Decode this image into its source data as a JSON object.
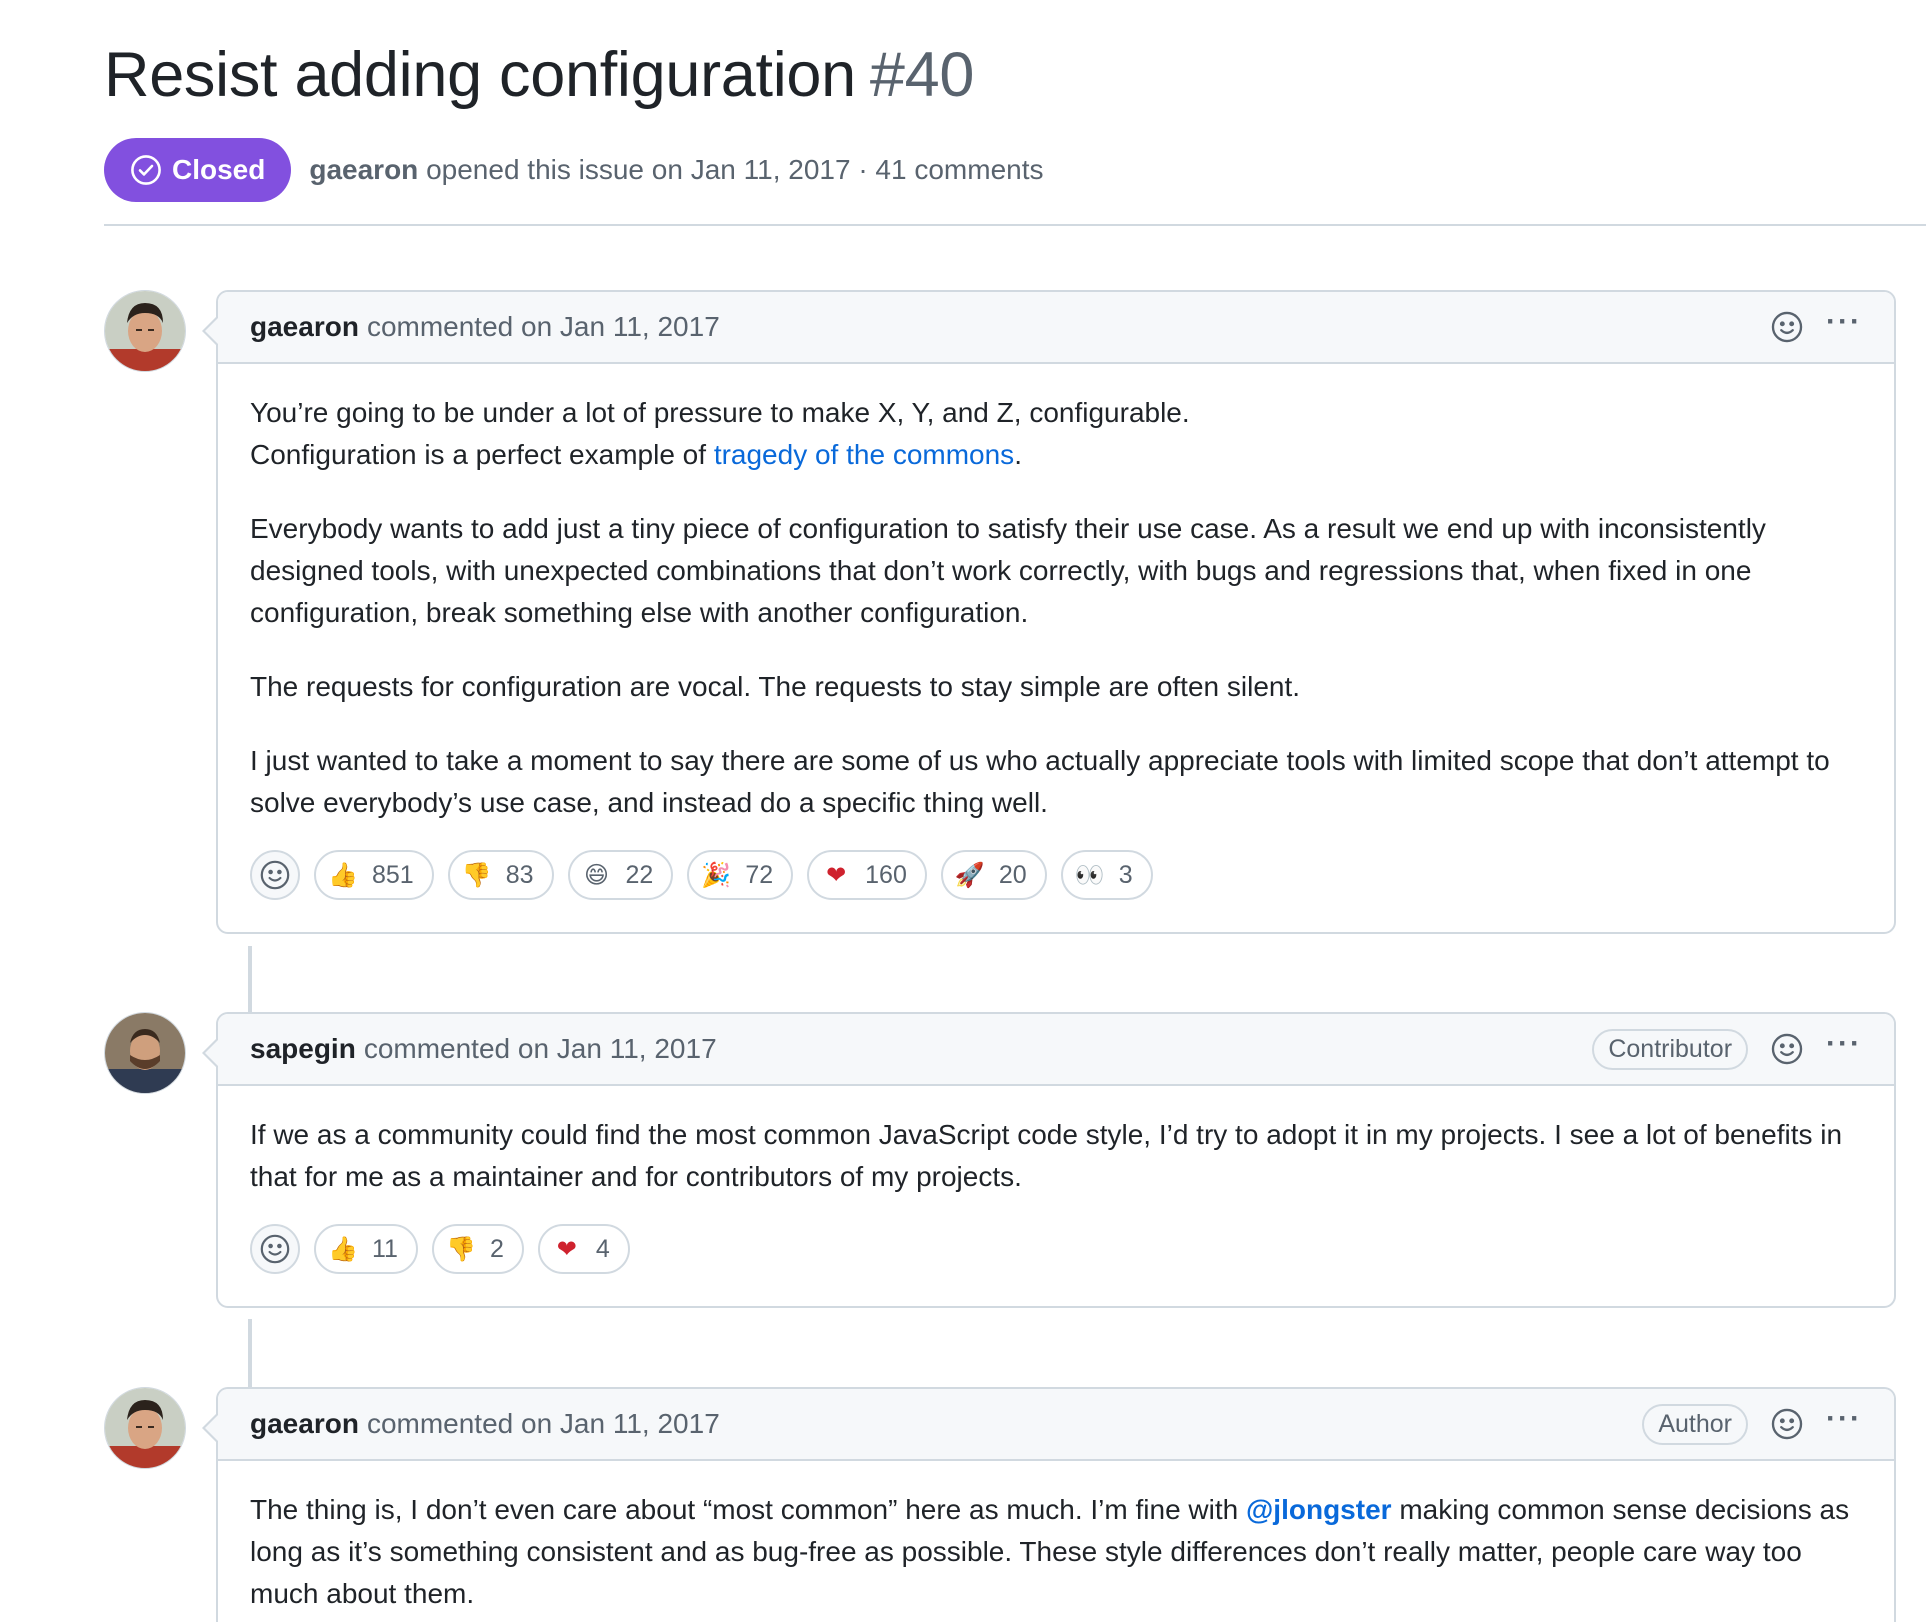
{
  "issue": {
    "title": "Resist adding configuration",
    "number": "#40",
    "state": "Closed",
    "author": "gaearon",
    "meta": "opened this issue on Jan 11, 2017 · 41 comments"
  },
  "colors": {
    "closed_badge": "#8250df",
    "link": "#0969da",
    "border": "#d1d9e0"
  },
  "comments": [
    {
      "author": "gaearon",
      "date_text": "commented on Jan 11, 2017",
      "role": "",
      "paragraphs": {
        "p1_line1": "You’re going to be under a lot of pressure to make X, Y, and Z, configurable.",
        "p1_line2_pre": "Configuration is a perfect example of ",
        "p1_link": "tragedy of the commons",
        "p1_line2_post": ".",
        "p2": "Everybody wants to add just a tiny piece of configuration to satisfy their use case. As a result we end up with inconsistently designed tools, with unexpected combinations that don’t work correctly, with bugs and regressions that, when fixed in one configuration, break something else with another configuration.",
        "p3": "The requests for configuration are vocal. The requests to stay simple are often silent.",
        "p4": "I just wanted to take a moment to say there are some of us who actually appreciate tools with limited scope that don’t attempt to solve everybody’s use case, and instead do a specific thing well."
      },
      "reactions": [
        {
          "icon": "thumbs-up-icon",
          "emoji": "👍",
          "count": "851"
        },
        {
          "icon": "thumbs-down-icon",
          "emoji": "👎",
          "count": "83"
        },
        {
          "icon": "laugh-icon",
          "emoji": "😄",
          "count": "22"
        },
        {
          "icon": "hooray-icon",
          "emoji": "🎉",
          "count": "72"
        },
        {
          "icon": "heart-icon",
          "emoji": "❤",
          "count": "160"
        },
        {
          "icon": "rocket-icon",
          "emoji": "🚀",
          "count": "20"
        },
        {
          "icon": "eyes-icon",
          "emoji": "👀",
          "count": "3"
        }
      ]
    },
    {
      "author": "sapegin",
      "date_text": "commented on Jan 11, 2017",
      "role": "Contributor",
      "paragraphs": {
        "p1": "If we as a community could find the most common JavaScript code style, I’d try to adopt it in my projects. I see a lot of benefits in that for me as a maintainer and for contributors of my projects."
      },
      "reactions": [
        {
          "icon": "thumbs-up-icon",
          "emoji": "👍",
          "count": "11"
        },
        {
          "icon": "thumbs-down-icon",
          "emoji": "👎",
          "count": "2"
        },
        {
          "icon": "heart-icon",
          "emoji": "❤",
          "count": "4"
        }
      ]
    },
    {
      "author": "gaearon",
      "date_text": "commented on Jan 11, 2017",
      "role": "Author",
      "paragraphs": {
        "p1_pre": "The thing is, I don’t even care about “most common” here as much. I’m fine with ",
        "p1_mention": "@jlongster",
        "p1_post": " making common sense decisions as long as it’s something consistent and as bug-free as possible. These style differences don’t really matter, people care way too much about them."
      }
    }
  ]
}
